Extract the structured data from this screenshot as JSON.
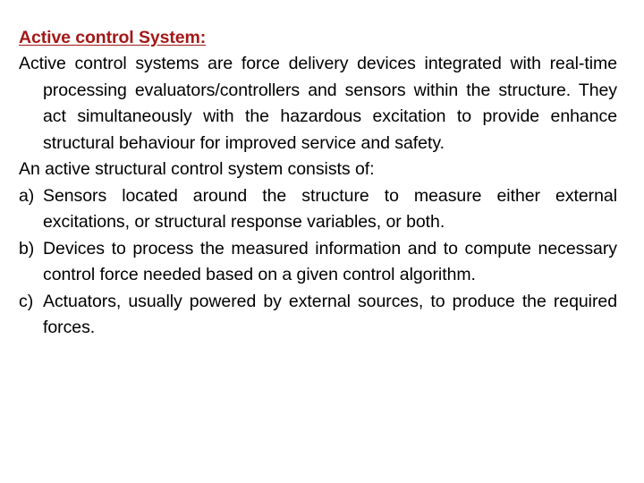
{
  "slide": {
    "background_color": "#ffffff",
    "heading": {
      "text": "Active control System:",
      "color": "#a31818",
      "bold": true,
      "underline": true
    },
    "paragraphs": [
      {
        "id": "intro",
        "text": "Active control systems are force delivery devices integrated with real-time processing evaluators/controllers and sensors within the structure. They act simultaneously with the hazardous excitation to provide enhance structural behaviour for improved service and safety."
      },
      {
        "id": "lead-in",
        "text": "An active structural control system consists of:"
      }
    ],
    "list": {
      "items": [
        {
          "marker": "a)",
          "text": "Sensors located around the structure to measure either external excitations, or structural response variables, or both."
        },
        {
          "marker": "b)",
          "text": "Devices to process the measured information and to compute necessary control force needed based on a given control algorithm."
        },
        {
          "marker": "c)",
          "text": "Actuators, usually powered by external sources, to produce the required forces."
        }
      ]
    }
  }
}
